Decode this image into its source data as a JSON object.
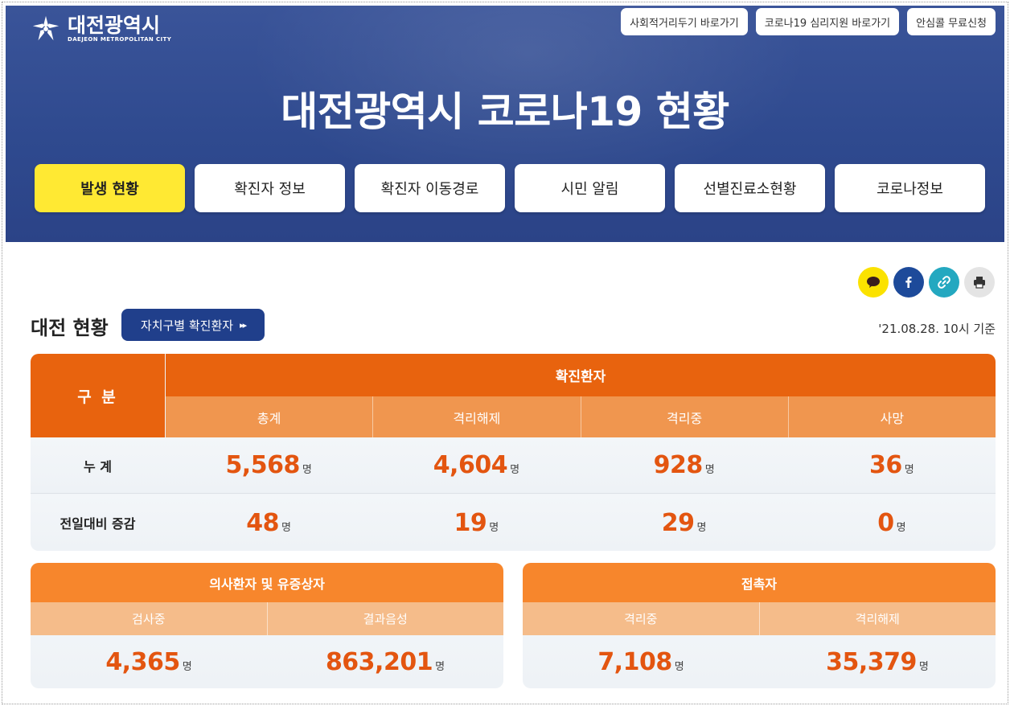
{
  "header": {
    "logo_ko": "대전광역시",
    "logo_en": "DAEJEON METROPOLITAN CITY",
    "top_links": [
      "사회적거리두기 바로가기",
      "코로나19 심리지원 바로가기",
      "안심콜 무료신청"
    ],
    "title": "대전광역시 코로나19 현황",
    "tabs": [
      "발생 현황",
      "확진자 정보",
      "확진자 이동경로",
      "시민 알림",
      "선별진료소현황",
      "코로나정보"
    ],
    "active_tab": "발생 현황"
  },
  "share_icons": [
    "kakaotalk-icon",
    "facebook-icon",
    "link-icon",
    "print-icon"
  ],
  "section": {
    "title": "대전 현황",
    "button_label": "자치구별 확진환자",
    "button_arrow": "▸▸",
    "basis": "'21.08.28. 10시 기준"
  },
  "main_table": {
    "corner": "구 분",
    "group_header": "확진환자",
    "columns": [
      "총계",
      "격리해제",
      "격리중",
      "사망"
    ],
    "unit": "명",
    "rows": [
      {
        "label": "누 계",
        "values": [
          "5,568",
          "4,604",
          "928",
          "36"
        ]
      },
      {
        "label": "전일대비 증감",
        "values": [
          "48",
          "19",
          "29",
          "0"
        ]
      }
    ]
  },
  "suspect_box": {
    "title": "의사환자 및 유증상자",
    "columns": [
      "검사중",
      "결과음성"
    ],
    "values": [
      "4,365",
      "863,201"
    ]
  },
  "contact_box": {
    "title": "접촉자",
    "columns": [
      "격리중",
      "격리해제"
    ],
    "values": [
      "7,108",
      "35,379"
    ]
  },
  "colors": {
    "header_bg": "#2f4a8f",
    "active_tab": "#ffe933",
    "orange_dark": "#e8630e",
    "orange_mid": "#f0964f",
    "orange_light": "#f5bc8a",
    "number": "#e35510",
    "navy_button": "#203f8b"
  }
}
